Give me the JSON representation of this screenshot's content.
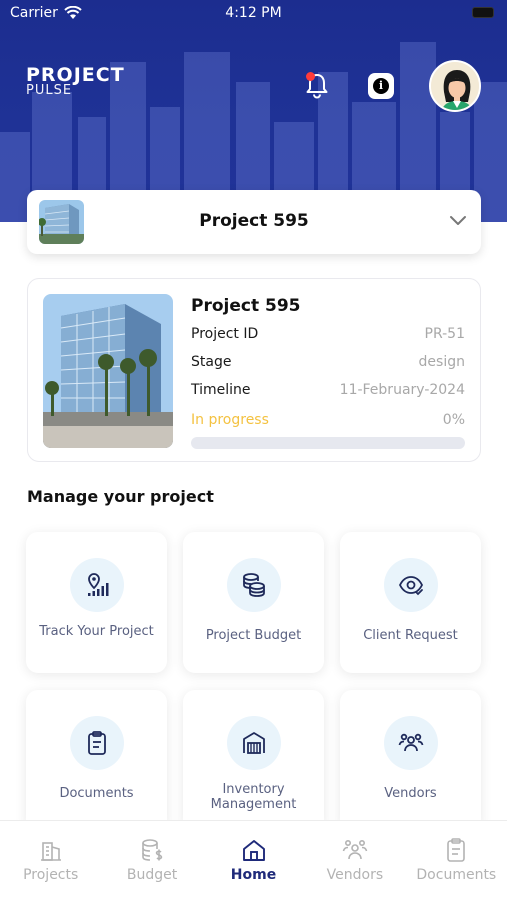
{
  "status_bar": {
    "carrier": "Carrier",
    "time": "4:12 PM"
  },
  "header": {
    "logo_main": "PROJECT",
    "logo_sub": "PULSE"
  },
  "selector": {
    "title": "Project 595"
  },
  "project": {
    "name": "Project 595",
    "rows": [
      {
        "label": "Project ID",
        "value": "PR-51"
      },
      {
        "label": "Stage",
        "value": "design"
      },
      {
        "label": "Timeline",
        "value": "11-February-2024"
      }
    ],
    "status_label": "In progress",
    "progress_text": "0%",
    "progress_fraction": 0
  },
  "manage": {
    "title": "Manage your project",
    "tiles": [
      {
        "label": "Track Your Project",
        "icon": "location-signal-icon"
      },
      {
        "label": "Project Budget",
        "icon": "coins-stack-icon"
      },
      {
        "label": "Client Request",
        "icon": "eye-check-icon"
      },
      {
        "label": "Documents",
        "icon": "clipboard-icon"
      },
      {
        "label": "Inventory Management",
        "icon": "warehouse-icon"
      },
      {
        "label": "Vendors",
        "icon": "users-group-icon"
      }
    ]
  },
  "tabbar": {
    "tabs": [
      {
        "label": "Projects",
        "icon": "building-icon"
      },
      {
        "label": "Budget",
        "icon": "coins-dollar-icon"
      },
      {
        "label": "Home",
        "icon": "home-icon"
      },
      {
        "label": "Vendors",
        "icon": "users-group-icon"
      },
      {
        "label": "Documents",
        "icon": "clipboard-icon"
      }
    ],
    "active": "Home"
  },
  "colors": {
    "header": "#1f3296",
    "accent": "#1f2a7a",
    "in_progress": "#f4c241",
    "icon_bg": "#e9f4fb"
  }
}
